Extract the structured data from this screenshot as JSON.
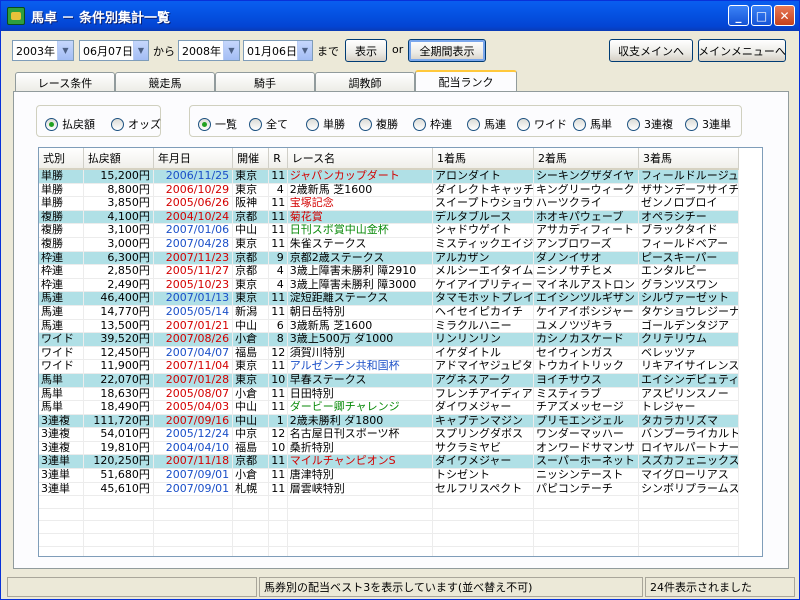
{
  "window": {
    "title": "馬卓 － 条件別集計一覧"
  },
  "filters": {
    "from_year": "2003年",
    "from_date": "06月07日",
    "from_label": "から",
    "to_year": "2008年",
    "to_date": "01月06日",
    "to_label": "まで",
    "show_button": "表示",
    "or_label": "or",
    "all_period_button": "全期間表示",
    "balance_menu_button": "収支メインへ",
    "main_menu_button": "メインメニューへ"
  },
  "tabs": [
    {
      "label": "レース条件"
    },
    {
      "label": "競走馬"
    },
    {
      "label": "騎手"
    },
    {
      "label": "調教師"
    },
    {
      "label": "配当ランク"
    }
  ],
  "options": {
    "metric": [
      {
        "label": "払戻額",
        "checked": true
      },
      {
        "label": "オッズ",
        "checked": false
      }
    ],
    "bet_types": [
      {
        "label": "一覧",
        "checked": true
      },
      {
        "label": "全て",
        "checked": false
      },
      {
        "label": "単勝",
        "checked": false
      },
      {
        "label": "複勝",
        "checked": false
      },
      {
        "label": "枠連",
        "checked": false
      },
      {
        "label": "馬連",
        "checked": false
      },
      {
        "label": "ワイド",
        "checked": false
      },
      {
        "label": "馬単",
        "checked": false
      },
      {
        "label": "3連複",
        "checked": false
      },
      {
        "label": "3連単",
        "checked": false
      }
    ]
  },
  "table": {
    "columns": [
      "式別",
      "払戻額",
      "年月日",
      "開催",
      "R",
      "レース名",
      "1着馬",
      "2着馬",
      "3着馬"
    ],
    "rows": [
      {
        "type": "単勝",
        "payout": "15,200円",
        "date": "2006/11/25",
        "venue": "東京",
        "r": "11",
        "race": "ジャパンカップダート",
        "race_color": "red",
        "first": "アロンダイト",
        "second": "シーキングザダイヤ",
        "third": "フィールドルージュ",
        "hl": true,
        "date_color": "blue"
      },
      {
        "type": "単勝",
        "payout": "8,800円",
        "date": "2006/10/29",
        "venue": "東京",
        "r": "4",
        "race": "2歳新馬 芝1600",
        "race_color": "black",
        "first": "ダイレクトキャッチ",
        "second": "キングリーウィーク",
        "third": "ザサンデーフサイチ",
        "hl": false,
        "date_color": "red"
      },
      {
        "type": "単勝",
        "payout": "3,850円",
        "date": "2005/06/26",
        "venue": "阪神",
        "r": "11",
        "race": "宝塚記念",
        "race_color": "red",
        "first": "スイープトウショウ",
        "second": "ハーツクライ",
        "third": "ゼンノロブロイ",
        "hl": false,
        "date_color": "red"
      },
      {
        "type": "複勝",
        "payout": "4,100円",
        "date": "2004/10/24",
        "venue": "京都",
        "r": "11",
        "race": "菊花賞",
        "race_color": "red",
        "first": "デルタブルース",
        "second": "ホオキパウェーブ",
        "third": "オペラシチー",
        "hl": true,
        "date_color": "red"
      },
      {
        "type": "複勝",
        "payout": "3,100円",
        "date": "2007/01/06",
        "venue": "中山",
        "r": "11",
        "race": "日刊スポ賞中山金杯",
        "race_color": "green",
        "first": "シャドウゲイト",
        "second": "アサカディフィート",
        "third": "ブラックタイド",
        "hl": false,
        "date_color": "blue"
      },
      {
        "type": "複勝",
        "payout": "3,000円",
        "date": "2007/04/28",
        "venue": "東京",
        "r": "11",
        "race": "朱雀ステークス",
        "race_color": "black",
        "first": "ミスティックエイジ",
        "second": "アンブロワーズ",
        "third": "フィールドベアー",
        "hl": false,
        "date_color": "blue"
      },
      {
        "type": "枠連",
        "payout": "6,300円",
        "date": "2007/11/23",
        "venue": "京都",
        "r": "9",
        "race": "京都2歳ステークス",
        "race_color": "black",
        "first": "アルカザン",
        "second": "ダノンイサオ",
        "third": "ピースキーパー",
        "hl": true,
        "date_color": "red"
      },
      {
        "type": "枠連",
        "payout": "2,850円",
        "date": "2005/11/27",
        "venue": "京都",
        "r": "4",
        "race": "3歳上障害未勝利 障2910",
        "race_color": "black",
        "first": "メルシーエイタイム",
        "second": "ニシノサチヒメ",
        "third": "エンタルピー",
        "hl": false,
        "date_color": "red"
      },
      {
        "type": "枠連",
        "payout": "2,490円",
        "date": "2005/10/23",
        "venue": "東京",
        "r": "4",
        "race": "3歳上障害未勝利 障3000",
        "race_color": "black",
        "first": "ケイアイプリティー",
        "second": "マイネルアストロン",
        "third": "グランツスワン",
        "hl": false,
        "date_color": "red"
      },
      {
        "type": "馬連",
        "payout": "46,400円",
        "date": "2007/01/13",
        "venue": "東京",
        "r": "11",
        "race": "淀短距離ステークス",
        "race_color": "black",
        "first": "タマモホットプレイ",
        "second": "エイシンツルギザン",
        "third": "シルヴァーゼット",
        "hl": true,
        "date_color": "blue"
      },
      {
        "type": "馬連",
        "payout": "14,770円",
        "date": "2005/05/14",
        "venue": "新潟",
        "r": "11",
        "race": "朝日岳特別",
        "race_color": "black",
        "first": "ヘイセイピカイチ",
        "second": "ケイアイボシジャー",
        "third": "タケショウレジーナ",
        "hl": false,
        "date_color": "blue"
      },
      {
        "type": "馬連",
        "payout": "13,500円",
        "date": "2007/01/21",
        "venue": "中山",
        "r": "6",
        "race": "3歳新馬 芝1600",
        "race_color": "black",
        "first": "ミラクルハニー",
        "second": "ユメノツヅキラ",
        "third": "ゴールデンタジア",
        "hl": false,
        "date_color": "red"
      },
      {
        "type": "ワイド",
        "payout": "39,520円",
        "date": "2007/08/26",
        "venue": "小倉",
        "r": "8",
        "race": "3歳上500万 ダ1000",
        "race_color": "black",
        "first": "リンリンリン",
        "second": "カシノカスケード",
        "third": "クリテリウム",
        "hl": true,
        "date_color": "red"
      },
      {
        "type": "ワイド",
        "payout": "12,450円",
        "date": "2007/04/07",
        "venue": "福島",
        "r": "12",
        "race": "須賀川特別",
        "race_color": "black",
        "first": "イケダイトル",
        "second": "セイウィンガス",
        "third": "ベレッツァ",
        "hl": false,
        "date_color": "blue"
      },
      {
        "type": "ワイド",
        "payout": "11,900円",
        "date": "2007/11/04",
        "venue": "東京",
        "r": "11",
        "race": "アルゼンチン共和国杯",
        "race_color": "blue",
        "first": "アドマイヤジュピタ",
        "second": "トウカイトリック",
        "third": "リキアイサイレンス",
        "hl": false,
        "date_color": "red"
      },
      {
        "type": "馬単",
        "payout": "22,070円",
        "date": "2007/01/28",
        "venue": "東京",
        "r": "10",
        "race": "早春ステークス",
        "race_color": "black",
        "first": "アグネスアーク",
        "second": "ヨイチサウス",
        "third": "エイシンデピュティ",
        "hl": true,
        "date_color": "red"
      },
      {
        "type": "馬単",
        "payout": "18,630円",
        "date": "2005/08/07",
        "venue": "小倉",
        "r": "11",
        "race": "日田特別",
        "race_color": "black",
        "first": "フレンチアイディア",
        "second": "ミスティラブ",
        "third": "アスピリンスノー",
        "hl": false,
        "date_color": "red"
      },
      {
        "type": "馬単",
        "payout": "18,490円",
        "date": "2005/04/03",
        "venue": "中山",
        "r": "11",
        "race": "ダービー卿チャレンジ",
        "race_color": "green",
        "first": "ダイワメジャー",
        "second": "チアズメッセージ",
        "third": "トレジャー",
        "hl": false,
        "date_color": "red"
      },
      {
        "type": "3連複",
        "payout": "111,720円",
        "date": "2007/09/16",
        "venue": "中山",
        "r": "1",
        "race": "2歳未勝利 ダ1800",
        "race_color": "black",
        "first": "キャプテンマジン",
        "second": "プリモエンジェル",
        "third": "タカラカリズマ",
        "hl": true,
        "date_color": "red"
      },
      {
        "type": "3連複",
        "payout": "54,010円",
        "date": "2005/12/24",
        "venue": "中京",
        "r": "12",
        "race": "名古屋日刊スポーツ杯",
        "race_color": "black",
        "first": "スプリングダボス",
        "second": "ワンダーマッハー",
        "third": "バンブーライカルト",
        "hl": false,
        "date_color": "blue"
      },
      {
        "type": "3連複",
        "payout": "19,810円",
        "date": "2004/04/10",
        "venue": "福島",
        "r": "10",
        "race": "桑折特別",
        "race_color": "black",
        "first": "サクラミヤビ",
        "second": "オンワードサマンサ",
        "third": "ロイヤルパートナー",
        "hl": false,
        "date_color": "blue"
      },
      {
        "type": "3連単",
        "payout": "120,250円",
        "date": "2007/11/18",
        "venue": "京都",
        "r": "11",
        "race": "マイルチャンピオンS",
        "race_color": "red",
        "first": "ダイワメジャー",
        "second": "スーパーホーネット",
        "third": "スズカフェニックス",
        "hl": true,
        "date_color": "red"
      },
      {
        "type": "3連単",
        "payout": "51,680円",
        "date": "2007/09/01",
        "venue": "小倉",
        "r": "11",
        "race": "唐津特別",
        "race_color": "black",
        "first": "トシゼント",
        "second": "ニッシンテースト",
        "third": "マイグローリアス",
        "hl": false,
        "date_color": "blue"
      },
      {
        "type": "3連単",
        "payout": "45,610円",
        "date": "2007/09/01",
        "venue": "札幌",
        "r": "11",
        "race": "層雲峡特別",
        "race_color": "black",
        "first": "セルフリスペクト",
        "second": "パピコンテーチ",
        "third": "シンボリプラームス",
        "hl": false,
        "date_color": "blue"
      }
    ]
  },
  "status": {
    "left": "",
    "message": "馬券別の配当ベスト3を表示しています(並べ替え不可)",
    "count": "24件表示されました"
  },
  "colors": {
    "highlight_row": "#b0e0e6",
    "date_blue": "#1a4fc8",
    "date_red": "#d40000"
  }
}
